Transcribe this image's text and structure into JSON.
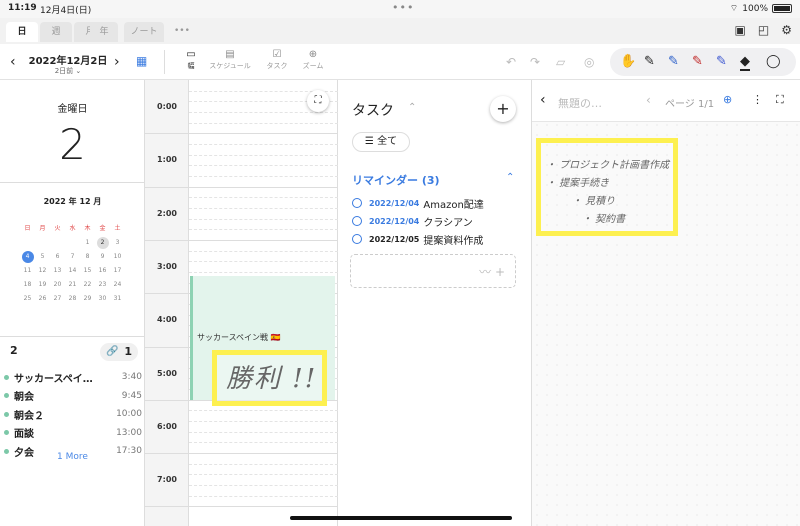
{
  "status": {
    "time": "11:19",
    "date": "12月4日(日)",
    "battery": "100%"
  },
  "view_tabs": [
    "日",
    "週",
    "月",
    "年",
    "ノート"
  ],
  "toolbar": {
    "date_title": "2022年12月2日",
    "date_sub": "2日前",
    "tools": [
      {
        "icon": "width-icon",
        "label": "幅"
      },
      {
        "icon": "schedule-icon",
        "label": "スケジュール"
      },
      {
        "icon": "task-icon",
        "label": "タスク"
      },
      {
        "icon": "zoom-icon",
        "label": "ズーム"
      }
    ]
  },
  "day": {
    "weekday": "金曜日",
    "number": "2"
  },
  "mini_calendar": {
    "month_label": "2022 年 12 月",
    "weekdays": [
      "日",
      "月",
      "火",
      "水",
      "木",
      "金",
      "土"
    ],
    "weeks": [
      [
        "",
        "",
        "",
        "",
        "1",
        "2",
        "3"
      ],
      [
        "4",
        "5",
        "6",
        "7",
        "8",
        "9",
        "10"
      ],
      [
        "11",
        "12",
        "13",
        "14",
        "15",
        "16",
        "17"
      ],
      [
        "18",
        "19",
        "20",
        "21",
        "22",
        "23",
        "24"
      ],
      [
        "25",
        "26",
        "27",
        "28",
        "29",
        "30",
        "31"
      ]
    ]
  },
  "events": {
    "count": "2",
    "link_count": "1",
    "items": [
      {
        "title": "サッカースペイ…",
        "time": "3:40"
      },
      {
        "title": "朝会",
        "time": "9:45"
      },
      {
        "title": "朝会２",
        "time": "10:00"
      },
      {
        "title": "面談",
        "time": "13:00"
      },
      {
        "title": "夕会",
        "time": "17:30"
      }
    ],
    "more": "1 More"
  },
  "timeline": {
    "hours": [
      "0:00",
      "1:00",
      "2:00",
      "3:00",
      "4:00",
      "5:00",
      "6:00",
      "7:00"
    ],
    "event_title": "サッカースペイン戦 🇪🇸",
    "handwriting": "勝利 !!"
  },
  "tasks": {
    "title": "タスク",
    "filter": "全て",
    "reminder_header": "リマインダー (3)",
    "reminders": [
      {
        "date": "2022/12/04",
        "text": "Amazon配達",
        "overdue": false
      },
      {
        "date": "2022/12/04",
        "text": "クラシアン",
        "overdue": false
      },
      {
        "date": "2022/12/05",
        "text": "提案資料作成",
        "overdue": true
      }
    ]
  },
  "note": {
    "title": "無題の…",
    "page": "ページ 1/1",
    "handwriting": [
      "・ プロジェクト計画書作成",
      "・ 提案手続き",
      "・ 見積り",
      "・ 契約書"
    ]
  }
}
